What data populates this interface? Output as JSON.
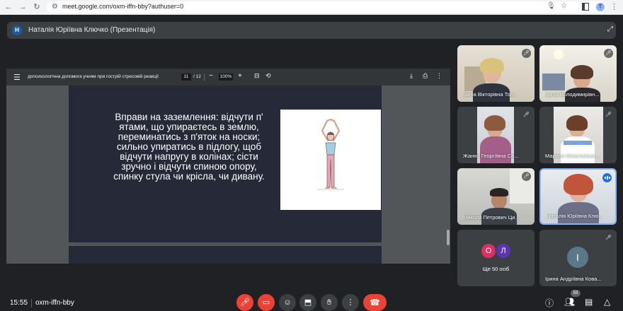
{
  "browser": {
    "url": "meet.google.com/oxm-iffn-bby?authuser=0",
    "profile_initial": "T"
  },
  "presenter": {
    "initial": "Н",
    "title": "Наталія Юріївна Ключко (Презентація)"
  },
  "pdf": {
    "filename": "допсихологічна допомога учням при гострій стресовій реакції",
    "page": "11",
    "page_total": "/ 12",
    "zoom": "100%",
    "slide_lines": [
      "Вправи на заземлення: відчути п'",
      "ятами, що упираєтесь в землю,",
      "переминатись з п'яток на носки;",
      "сильно упиратись в підлогу, щоб",
      "відчути напругу в колінах; сісти",
      "зручно і відчути спиною опору,",
      "спинку стула чи крісла, чи дивану."
    ]
  },
  "participants": [
    {
      "name": "Ірина Вікторівна Тол...",
      "muted": true
    },
    {
      "name": "Ірина Володимирівн...",
      "muted": true
    },
    {
      "name": "Жанна Георгіївна Са...",
      "muted": true
    },
    {
      "name": "Марина Миколаївна ...",
      "muted": true
    },
    {
      "name": "Микола Петрович Ци...",
      "muted": true
    },
    {
      "name": "Наталія Юріївна Клю...",
      "muted": false,
      "speaking": true
    },
    {
      "name": "Ще 50 осіб",
      "initials": [
        "О",
        "Л"
      ]
    },
    {
      "name": "Ірина Андріївна Кова...",
      "initial": "І",
      "muted": true
    }
  ],
  "bottom": {
    "time": "15:55",
    "meeting_code": "oxm-iffn-bby",
    "participant_count": "59"
  },
  "colors": {
    "background": "#202124",
    "tile": "#3c4043",
    "red": "#ea4335",
    "accent": "#8ab4f8",
    "presenter_avatar": "#1a5ea8",
    "avatar_o": "#d93164",
    "avatar_l": "#5e35b1",
    "avatar_i": "#5b7889"
  }
}
